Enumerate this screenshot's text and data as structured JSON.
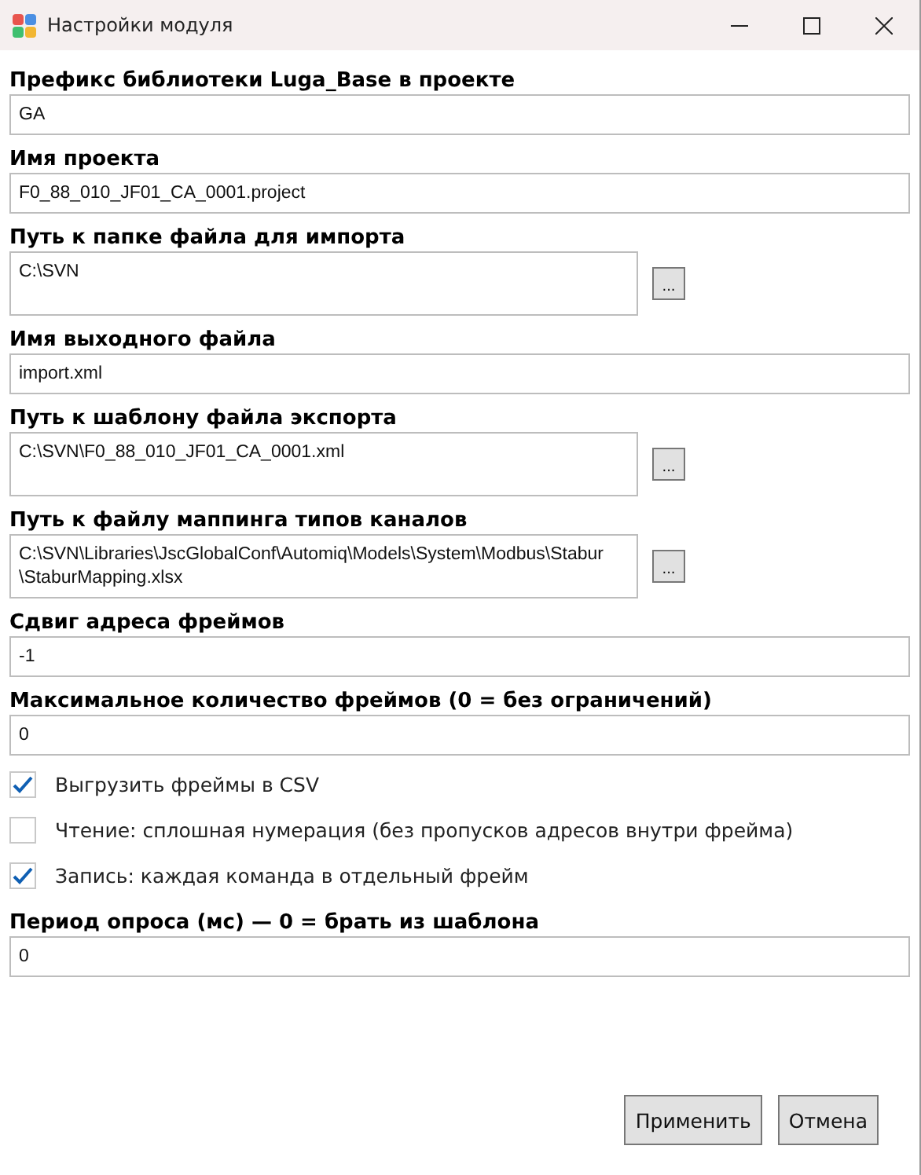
{
  "window": {
    "title": "Настройки модуля"
  },
  "items": [
    {
      "kind": "field",
      "label": "Префикс библиотеки Luga_Base в проекте",
      "value": "GA"
    },
    {
      "kind": "field",
      "label": "Имя проекта",
      "value": "F0_88_010_JF01_CA_0001.project"
    },
    {
      "kind": "path",
      "label": "Путь к папке файла для импорта",
      "value": "C:\\SVN",
      "browse": "..."
    },
    {
      "kind": "field",
      "label": "Имя выходного файла",
      "value": "import.xml"
    },
    {
      "kind": "path",
      "label": "Путь к шаблону файла экспорта",
      "value": "C:\\SVN\\F0_88_010_JF01_CA_0001.xml",
      "browse": "..."
    },
    {
      "kind": "path",
      "label": "Путь к файлу маппинга типов каналов",
      "value": "C:\\SVN\\Libraries\\JscGlobalConf\\Automiq\\Models\\System\\Modbus\\Stabur\n\\StaburMapping.xlsx",
      "browse": "..."
    },
    {
      "kind": "field",
      "label": "Сдвиг адреса фреймов",
      "value": "-1"
    },
    {
      "kind": "field",
      "label": "Максимальное количество фреймов (0 = без ограничений)",
      "value": "0"
    },
    {
      "kind": "checkbox",
      "label": "Выгрузить фреймы в CSV",
      "checked": true
    },
    {
      "kind": "checkbox",
      "label": "Чтение: сплошная нумерация (без пропусков адресов внутри фрейма)",
      "checked": false
    },
    {
      "kind": "checkbox",
      "label": "Запись: каждая команда в отдельный фрейм",
      "checked": true
    },
    {
      "kind": "field",
      "label": "Период опроса (мс) — 0 = брать из шаблона",
      "value": "0"
    }
  ],
  "buttons": [
    "Применить",
    "Отмена"
  ]
}
